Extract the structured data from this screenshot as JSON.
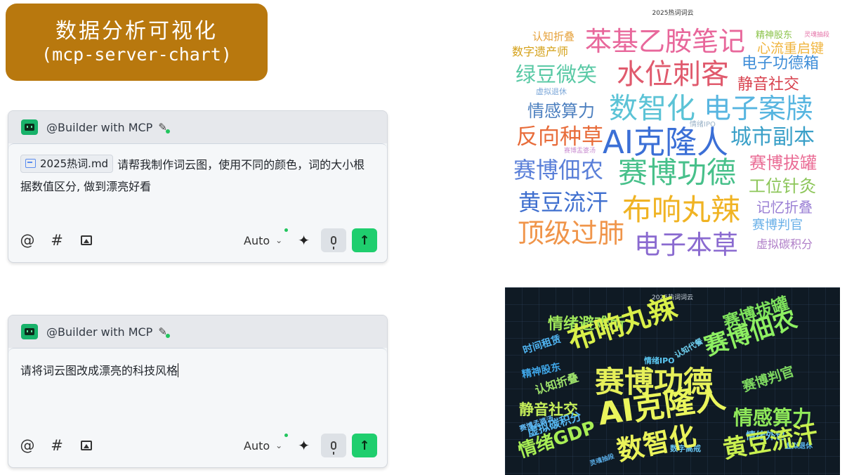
{
  "badge": {
    "line1": "数据分析可视化",
    "line2": "(mcp-server-chart)"
  },
  "prompt1": {
    "agent": "@Builder with MCP",
    "file_chip": "2025热词.md",
    "text": "请帮我制作词云图，使用不同的颜色，词的大小根据数值区分, 做到漂亮好看",
    "mode": "Auto",
    "icons": [
      "at-icon",
      "hash-icon",
      "image-icon",
      "sparkle-icon",
      "mic-icon",
      "send-arrow-icon"
    ]
  },
  "prompt2": {
    "agent": "@Builder with MCP",
    "text": "请将词云图改成漂亮的科技风格",
    "mode": "Auto"
  },
  "cloud1": {
    "title": "2025热词词云",
    "words": [
      {
        "text": "认知折叠",
        "color": "#e6a23c"
      },
      {
        "text": "苯基乙胺笔记",
        "color": "#e8679b"
      },
      {
        "text": "精神股东",
        "color": "#8bc34a"
      },
      {
        "text": "灵魂抽段",
        "color": "#e573a8"
      },
      {
        "text": "数字遗产师",
        "color": "#d4a017"
      },
      {
        "text": "心流重启键",
        "color": "#f0b43c"
      },
      {
        "text": "绿豆微笑",
        "color": "#59c9a5"
      },
      {
        "text": "水位刺客",
        "color": "#e05a6d"
      },
      {
        "text": "电子功德箱",
        "color": "#3f8ed8"
      },
      {
        "text": "虚拟退休",
        "color": "#7aa6d8"
      },
      {
        "text": "静音社交",
        "color": "#d8434f"
      },
      {
        "text": "情感算力",
        "color": "#4c7fbf"
      },
      {
        "text": "数智化",
        "color": "#5bc3d6"
      },
      {
        "text": "电子案牍",
        "color": "#57b5e0"
      },
      {
        "text": "情绪IPO",
        "color": "#9bb3c8"
      },
      {
        "text": "反向种草",
        "color": "#e86c3a"
      },
      {
        "text": "AI克隆人",
        "color": "#3b6fd6"
      },
      {
        "text": "城市副本",
        "color": "#3aa0c8"
      },
      {
        "text": "赛博盂婆汤",
        "color": "#c98ed0"
      },
      {
        "text": "赛博佃农",
        "color": "#5a7fd8"
      },
      {
        "text": "赛博功德",
        "color": "#47c08a"
      },
      {
        "text": "赛博拔罐",
        "color": "#ea6c95"
      },
      {
        "text": "工位针灸",
        "color": "#8dc65a"
      },
      {
        "text": "黄豆流汗",
        "color": "#3f6fcf"
      },
      {
        "text": "布响丸辣",
        "color": "#f0b323"
      },
      {
        "text": "记忆折叠",
        "color": "#9a7fd4"
      },
      {
        "text": "赛博判官",
        "color": "#6ab0e8"
      },
      {
        "text": "顶级过肺",
        "color": "#f0954a"
      },
      {
        "text": "电子本草",
        "color": "#8a6ad0"
      },
      {
        "text": "虚拟碳积分",
        "color": "#b07fc8"
      }
    ]
  },
  "cloud2": {
    "title": "2025热词词云",
    "words": [
      {
        "text": "情绪避难所",
        "color": "#9fe75a"
      },
      {
        "text": "赛博拔罐",
        "color": "#7ee25c"
      },
      {
        "text": "时间租赁",
        "color": "#4fb3f0"
      },
      {
        "text": "布响丸辣",
        "color": "#d9f04a"
      },
      {
        "text": "赛博佃农",
        "color": "#8ef062"
      },
      {
        "text": "精神股东",
        "color": "#3fa6e8"
      },
      {
        "text": "情绪IPO",
        "color": "#5bc7f2"
      },
      {
        "text": "认知代餐",
        "color": "#6fd0f0"
      },
      {
        "text": "认知折叠",
        "color": "#9de06a"
      },
      {
        "text": "赛博功德",
        "color": "#e6f05a"
      },
      {
        "text": "赛博判官",
        "color": "#7ed860"
      },
      {
        "text": "静音社交",
        "color": "#c6ef5a"
      },
      {
        "text": "AI克隆人",
        "color": "#eaf55c"
      },
      {
        "text": "情感算力",
        "color": "#8fe85a"
      },
      {
        "text": "赛博孟婆汤",
        "color": "#5fb6f0"
      },
      {
        "text": "虚拟碳积分",
        "color": "#57b8f2"
      },
      {
        "text": "情绪外包",
        "color": "#6cc8f0"
      },
      {
        "text": "数字高戒",
        "color": "#67c2ee"
      },
      {
        "text": "虚拟退休",
        "color": "#5ab3ea"
      },
      {
        "text": "情绪GDP",
        "color": "#a8ee55"
      },
      {
        "text": "数智化",
        "color": "#eaf35a"
      },
      {
        "text": "黄豆流汗",
        "color": "#c9f04f"
      },
      {
        "text": "灵魂抽段",
        "color": "#5aaee8"
      }
    ]
  }
}
